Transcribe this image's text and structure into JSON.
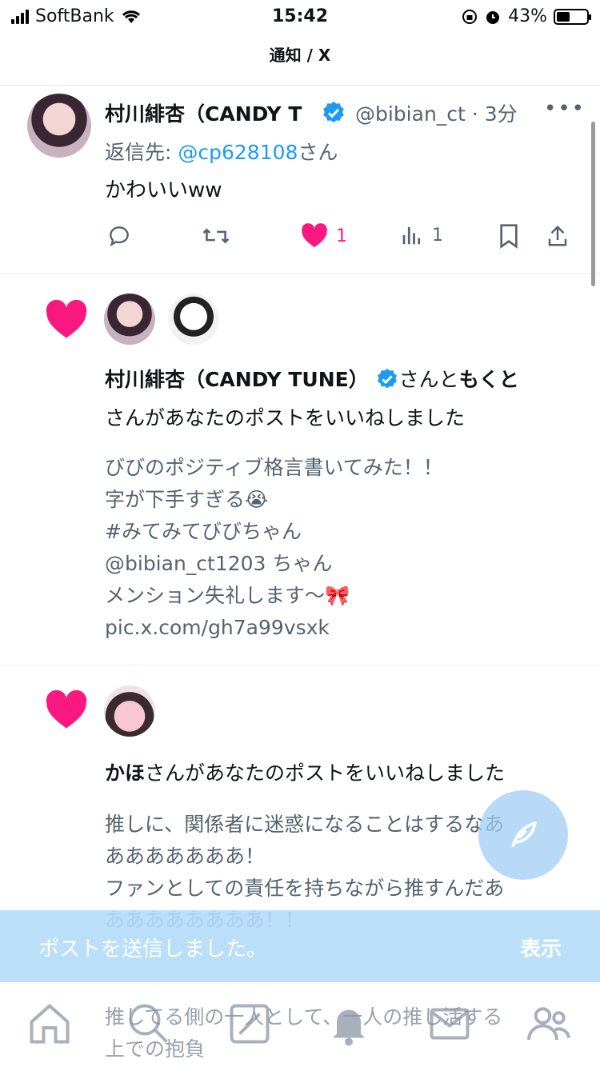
{
  "status_bar": {
    "carrier": "SoftBank",
    "time": "15:42",
    "battery": "43%"
  },
  "header": {
    "title": "通知 / X"
  },
  "tweet": {
    "name": "村川緋杏（CANDY T",
    "handle": "@bibian_ct",
    "time": "· 3分",
    "reply_prefix": "返信先: ",
    "reply_to": "@cp628108",
    "reply_suffix": "さん",
    "text": "かわいいww",
    "like_count": "1",
    "view_count": "1"
  },
  "notification1": {
    "actor1": "村川緋杏（CANDY TUNE）",
    "mid": "さんと",
    "actor2": "もくと",
    "line2": "さんがあなたのポストをいいねしました",
    "post": "びびのポジティブ格言書いてみた！！\n字が下手すぎる😭\n#みてみてびびちゃん\n@bibian_ct1203 ちゃん\nメンション失礼します〜🎀\npic.x.com/gh7a99vsxk"
  },
  "notification2": {
    "actor": "かほ",
    "line": "さんがあなたのポストをいいねしました",
    "post": "推しに、関係者に迷惑になることはするなあ\nあああああああ！\nファンとしての責任を持ちながら推すんだあ\nああああああああ！！",
    "post_more": "推してる側の一人として、一人の推し活する\n上での抱負"
  },
  "toast": {
    "message": "ポストを送信しました。",
    "action": "表示"
  },
  "colors": {
    "like": "#f91880",
    "link": "#1d9bf0",
    "muted": "#536471",
    "verified": "#1d9bf0"
  },
  "icons": [
    "home-icon",
    "search-icon",
    "grok-icon",
    "notifications-icon",
    "messages-icon",
    "communities-icon",
    "compose-icon"
  ]
}
